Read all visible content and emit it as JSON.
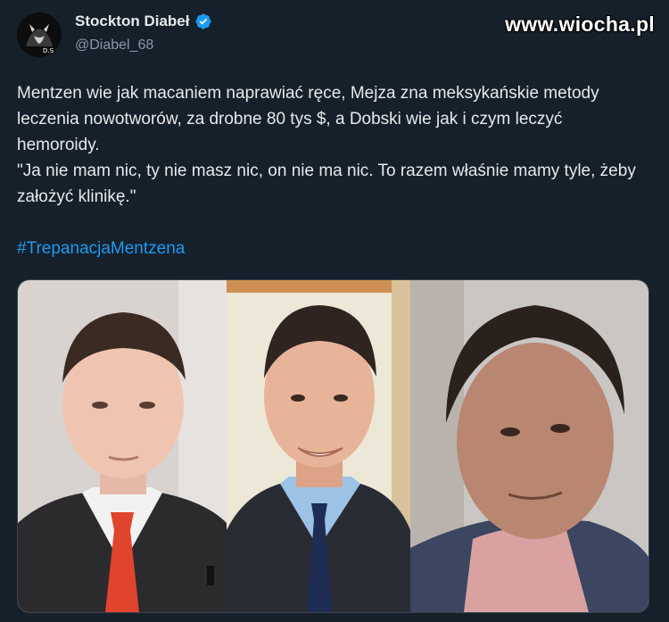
{
  "author": {
    "display_name": "Stockton Diabeł",
    "handle": "@Diabel_68",
    "avatar_icon": "devil-avatar-icon",
    "avatar_initials": "D.S",
    "verified_icon": "verified-badge-icon"
  },
  "watermark": "www.wiocha.pl",
  "tweet": {
    "paragraph_1": "Mentzen wie jak macaniem naprawiać ręce, Mejza zna meksykańskie metody leczenia nowotworów, za drobne 80 tys $, a Dobski wie jak i czym leczyć hemoroidy.",
    "paragraph_2": "\"Ja nie mam nic, ty nie masz nic, on nie ma nic. To razem właśnie mamy tyle, żeby założyć klinikę.\"",
    "hashtag": "#TrepanacjaMentzena"
  },
  "colors": {
    "background": "#15202b",
    "text": "#e7e9ea",
    "secondary": "#8b98a5",
    "link": "#1d9bf0",
    "verified": "#1d9bf0"
  }
}
